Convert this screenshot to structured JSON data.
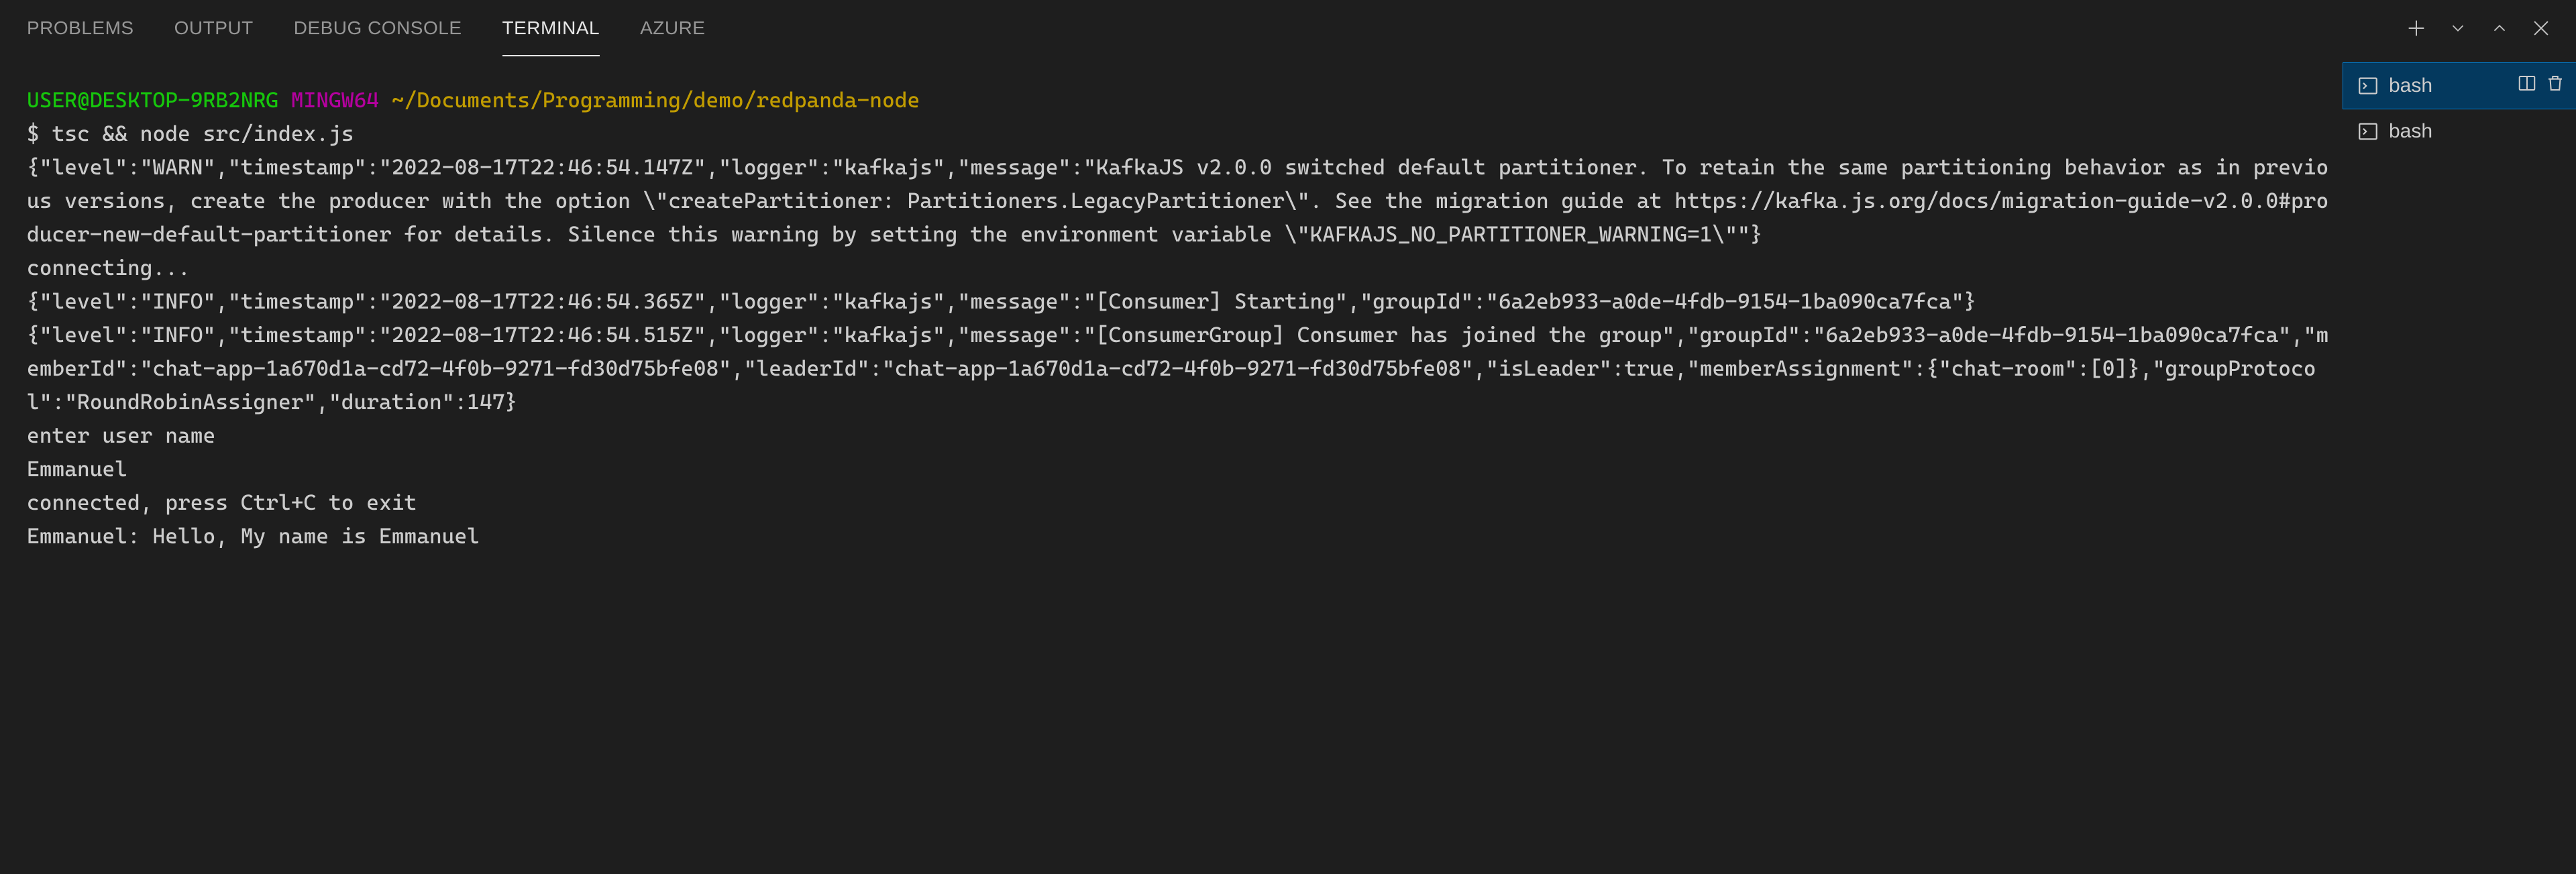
{
  "tabs": {
    "items": [
      {
        "label": "PROBLEMS",
        "active": false
      },
      {
        "label": "OUTPUT",
        "active": false
      },
      {
        "label": "DEBUG CONSOLE",
        "active": false
      },
      {
        "label": "TERMINAL",
        "active": true
      },
      {
        "label": "AZURE",
        "active": false
      }
    ]
  },
  "toolbar": {
    "new_terminal": "plus",
    "launch_profile": "chevron-down",
    "split": "split",
    "kill": "trash",
    "maximize": "chevron-up",
    "close": "close"
  },
  "prompt": {
    "user_host": "USER@DESKTOP-9RB2NRG",
    "shell": "MINGW64",
    "cwd": "~/Documents/Programming/demo/redpanda-node",
    "symbol": "$",
    "command": "tsc && node src/index.js"
  },
  "output_lines": [
    "{\"level\":\"WARN\",\"timestamp\":\"2022-08-17T22:46:54.147Z\",\"logger\":\"kafkajs\",\"message\":\"KafkaJS v2.0.0 switched default partitioner. To retain the same partitioning behavior as in previous versions, create the producer with the option \\\"createPartitioner: Partitioners.LegacyPartitioner\\\". See the migration guide at https://kafka.js.org/docs/migration-guide-v2.0.0#producer-new-default-partitioner for details. Silence this warning by setting the environment variable \\\"KAFKAJS_NO_PARTITIONER_WARNING=1\\\"\"}",
    "connecting...",
    "{\"level\":\"INFO\",\"timestamp\":\"2022-08-17T22:46:54.365Z\",\"logger\":\"kafkajs\",\"message\":\"[Consumer] Starting\",\"groupId\":\"6a2eb933-a0de-4fdb-9154-1ba090ca7fca\"}",
    "{\"level\":\"INFO\",\"timestamp\":\"2022-08-17T22:46:54.515Z\",\"logger\":\"kafkajs\",\"message\":\"[ConsumerGroup] Consumer has joined the group\",\"groupId\":\"6a2eb933-a0de-4fdb-9154-1ba090ca7fca\",\"memberId\":\"chat-app-1a670d1a-cd72-4f0b-9271-fd30d75bfe08\",\"leaderId\":\"chat-app-1a670d1a-cd72-4f0b-9271-fd30d75bfe08\",\"isLeader\":true,\"memberAssignment\":{\"chat-room\":[0]},\"groupProtocol\":\"RoundRobinAssigner\",\"duration\":147}",
    "enter user name",
    "Emmanuel",
    "connected, press Ctrl+C to exit",
    "Emmanuel: Hello, My name is Emmanuel"
  ],
  "sidebar": {
    "terminals": [
      {
        "label": "bash",
        "active": true,
        "has_split": true,
        "has_trash": true
      },
      {
        "label": "bash",
        "active": false,
        "has_split": false,
        "has_trash": false
      }
    ]
  }
}
